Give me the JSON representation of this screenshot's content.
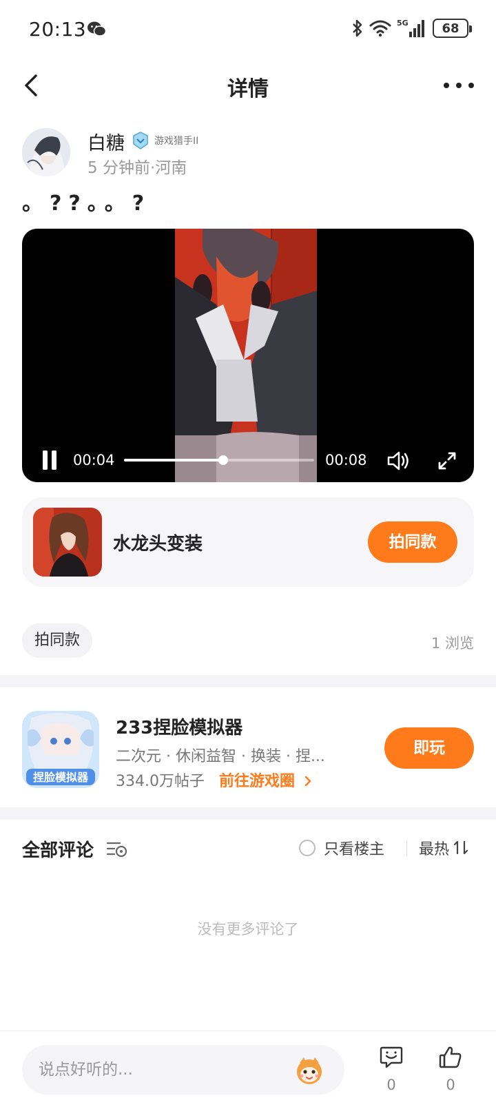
{
  "status_bar": {
    "time": "20:13",
    "battery": "68",
    "network": "5G"
  },
  "header": {
    "title": "详情"
  },
  "post": {
    "author_name": "白糖",
    "badge": "游戏猎手II",
    "meta": "5 分钟前·河南",
    "text": "。??。。?"
  },
  "video": {
    "current_time": "00:04",
    "total_time": "00:08",
    "progress": 0.52
  },
  "template_card": {
    "name": "水龙头变装",
    "button_label": "拍同款"
  },
  "tag_row": {
    "tag": "拍同款",
    "views": "1 浏览"
  },
  "game": {
    "name": "233捏脸模拟器",
    "tags": "二次元 · 休闲益智 · 换装 · 捏...",
    "posts": "334.0万帖子",
    "circle_link": "前往游戏圈",
    "play_label": "即玩"
  },
  "comments": {
    "title": "全部评论",
    "owner_only": "只看楼主",
    "sort": "最热",
    "empty": "没有更多评论了"
  },
  "bottom_bar": {
    "input_placeholder": "说点好听的...",
    "comment_count": "0",
    "like_count": "0"
  },
  "colors": {
    "accent": "#ff7a1a",
    "background": "#ffffff"
  }
}
